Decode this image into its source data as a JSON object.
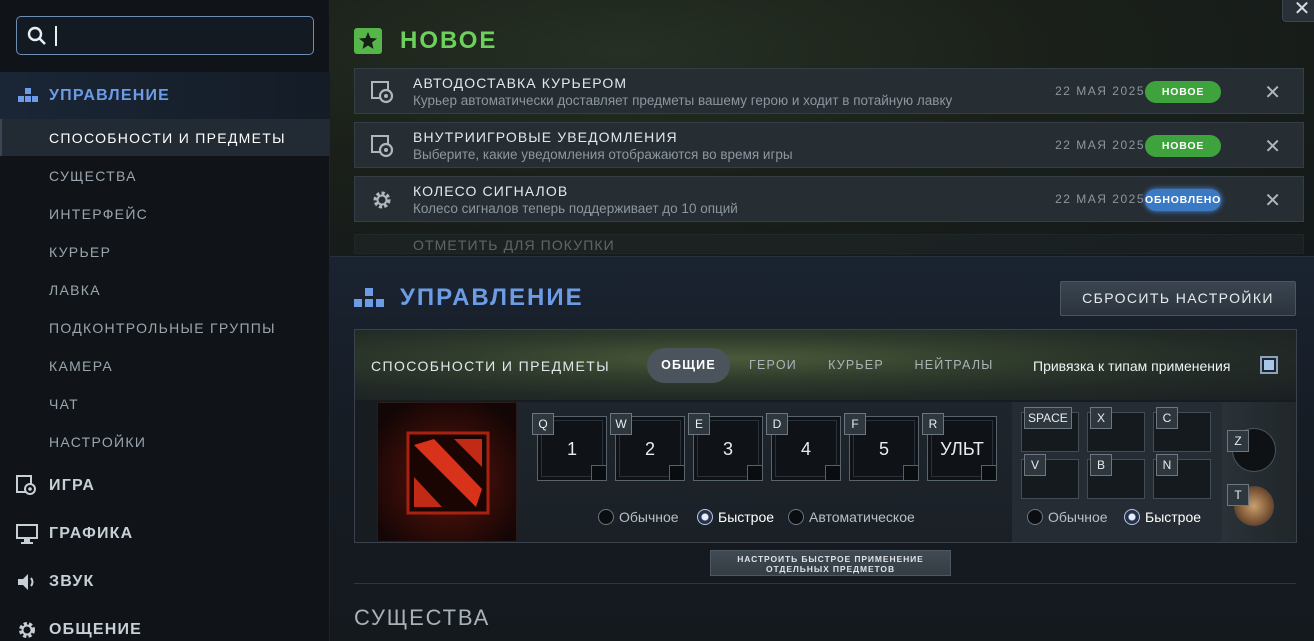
{
  "search": {
    "value": "",
    "placeholder": ""
  },
  "sidebar": {
    "main": {
      "label": "УПРАВЛЕНИЕ"
    },
    "subitems": [
      {
        "label": "СПОСОБНОСТИ И ПРЕДМЕТЫ"
      },
      {
        "label": "СУЩЕСТВА"
      },
      {
        "label": "ИНТЕРФЕЙС"
      },
      {
        "label": "КУРЬЕР"
      },
      {
        "label": "ЛАВКА"
      },
      {
        "label": "ПОДКОНТРОЛЬНЫЕ ГРУППЫ"
      },
      {
        "label": "КАМЕРА"
      },
      {
        "label": "ЧАТ"
      },
      {
        "label": "НАСТРОЙКИ"
      }
    ],
    "sections": [
      {
        "label": "ИГРА"
      },
      {
        "label": "ГРАФИКА"
      },
      {
        "label": "ЗВУК"
      },
      {
        "label": "ОБЩЕНИЕ"
      }
    ]
  },
  "new": {
    "title": "НОВОЕ",
    "items": [
      {
        "title": "АВТОДОСТАВКА КУРЬЕРОМ",
        "desc": "Курьер автоматически доставляет предметы вашему герою и ходит в потайную лавку",
        "date": "22 МАЯ 2025",
        "badge": "НОВОЕ"
      },
      {
        "title": "ВНУТРИИГРОВЫЕ УВЕДОМЛЕНИЯ",
        "desc": "Выберите, какие уведомления отображаются во время игры",
        "date": "22 МАЯ 2025",
        "badge": "НОВОЕ"
      },
      {
        "title": "КОЛЕСО СИГНАЛОВ",
        "desc": "Колесо сигналов теперь поддерживает до 10 опций",
        "date": "22 МАЯ 2025",
        "badge": "ОБНОВЛЕНО"
      },
      {
        "title": "ОТМЕТИТЬ ДЛЯ ПОКУПКИ"
      }
    ]
  },
  "controls": {
    "title": "УПРАВЛЕНИЕ",
    "reset_label": "СБРОСИТЬ НАСТРОЙКИ",
    "panel_label": "СПОСОБНОСТИ И ПРЕДМЕТЫ",
    "tabs": [
      {
        "label": "ОБЩИЕ"
      },
      {
        "label": "ГЕРОИ"
      },
      {
        "label": "КУРЬЕР"
      },
      {
        "label": "НЕЙТРАЛЫ"
      }
    ],
    "bind_label": "Привязка к типам применения",
    "bind_checked": true,
    "abilities": [
      {
        "letter": "Q",
        "value": "1"
      },
      {
        "letter": "W",
        "value": "2"
      },
      {
        "letter": "E",
        "value": "3"
      },
      {
        "letter": "D",
        "value": "4"
      },
      {
        "letter": "F",
        "value": "5"
      },
      {
        "letter": "R",
        "value": "УЛЬТ"
      }
    ],
    "cast_options": [
      {
        "label": "Обычное",
        "selected": false
      },
      {
        "label": "Быстрое",
        "selected": true
      },
      {
        "label": "Автоматическое",
        "selected": false
      }
    ],
    "item_keys": [
      "SPACE",
      "X",
      "C",
      "V",
      "B",
      "N"
    ],
    "item_cast_options": [
      {
        "label": "Обычное",
        "selected": false
      },
      {
        "label": "Быстрое",
        "selected": true
      }
    ],
    "side_keys": [
      "Z",
      "T"
    ],
    "config_button": [
      "НАСТРОИТЬ БЫСТРОЕ ПРИМЕНЕНИЕ",
      "ОТДЕЛЬНЫХ ПРЕДМЕТОВ"
    ],
    "next_section": "СУЩЕСТВА"
  },
  "colors": {
    "accent_blue": "#6d9ce6",
    "accent_green": "#6ed05c",
    "badge_new": "#3ea33c",
    "badge_updated": "#3a79c4"
  }
}
